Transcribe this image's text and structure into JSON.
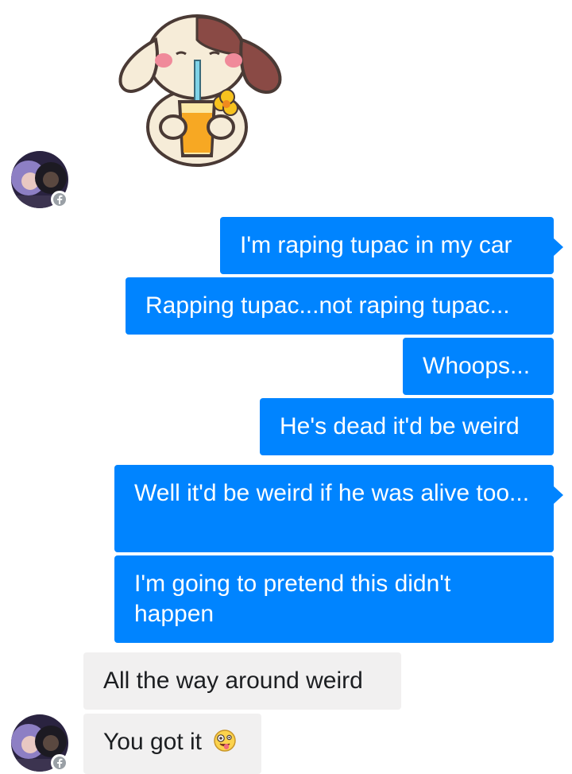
{
  "conversation": {
    "sticker_name": "puppy-drinking-juice-sticker",
    "colors": {
      "sent_bubble": "#0084ff",
      "received_bubble": "#f1f0f0",
      "badge": "#9aa0a6"
    },
    "avatar_badge_icon": "facebook-icon",
    "messages": [
      {
        "id": "m1",
        "direction": "sent",
        "text": "I'm raping tupac in my car"
      },
      {
        "id": "m2",
        "direction": "sent",
        "text": "Rapping tupac...not raping tupac..."
      },
      {
        "id": "m3",
        "direction": "sent",
        "text": "Whoops..."
      },
      {
        "id": "m4",
        "direction": "sent",
        "text": "He's dead it'd be weird"
      },
      {
        "id": "m5",
        "direction": "sent",
        "text": "Well it'd be weird if he was alive too..."
      },
      {
        "id": "m6",
        "direction": "sent",
        "text": "I'm going to pretend this didn't happen"
      },
      {
        "id": "m7",
        "direction": "received",
        "text": "All the way around weird"
      },
      {
        "id": "m8",
        "direction": "received",
        "text": "You got it",
        "emoji": "zany-face-icon"
      }
    ]
  }
}
